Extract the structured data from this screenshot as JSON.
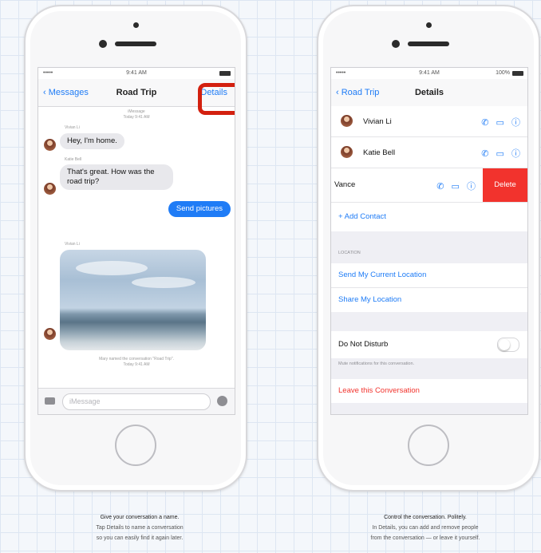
{
  "left_phone": {
    "status": {
      "carrier": "•••••",
      "time": "9:41 AM"
    },
    "nav": {
      "back": "Messages",
      "title": "Road Trip",
      "action": "Details"
    },
    "timestamp_top": [
      "iMessage",
      "Today 9:41 AM"
    ],
    "messages": [
      {
        "sender": "Vivian Li",
        "text": "Hey, I'm home.",
        "direction": "in"
      },
      {
        "sender": "Katie Bell",
        "text": "That's great. How was the road trip?",
        "direction": "in"
      },
      {
        "text": "Send pictures",
        "direction": "out"
      },
      {
        "sender": "Vivian Li",
        "type": "photo",
        "direction": "in"
      }
    ],
    "rename_notice": [
      "Mary named the conversation \"Road Trip\".",
      "Today 9:41 AM"
    ],
    "input_placeholder": "iMessage",
    "caption": {
      "title": "Give your conversation a name.",
      "lines": [
        "Tap Details to name a conversation",
        "so you can easily find it again later."
      ]
    }
  },
  "right_phone": {
    "status": {
      "carrier": "•••••",
      "time": "9:41 AM",
      "battery": "100%"
    },
    "nav": {
      "back": "Road Trip",
      "title": "Details"
    },
    "contacts": [
      {
        "name": "Vivian Li"
      },
      {
        "name": "Katie Bell"
      },
      {
        "name": "Vance"
      }
    ],
    "contact_action_icons": "✆ ▭ ⓘ",
    "swipe_delete": "Delete",
    "add_contact": "+  Add Contact",
    "location_header": "LOCATION",
    "send_location": "Send My Current Location",
    "share_location": "Share My Location",
    "dnd_label": "Do Not Disturb",
    "dnd_note": "Mute notifications for this conversation.",
    "leave": "Leave this Conversation",
    "caption": {
      "title": "Control the conversation. Politely.",
      "lines": [
        "In Details, you can add and remove people",
        "from the conversation — or leave it yourself."
      ]
    }
  },
  "colors": {
    "accent": "#1f7cf6",
    "delete": "#f2332d",
    "highlight": "#d3200f",
    "bubble_in": "#e8e8ec"
  }
}
